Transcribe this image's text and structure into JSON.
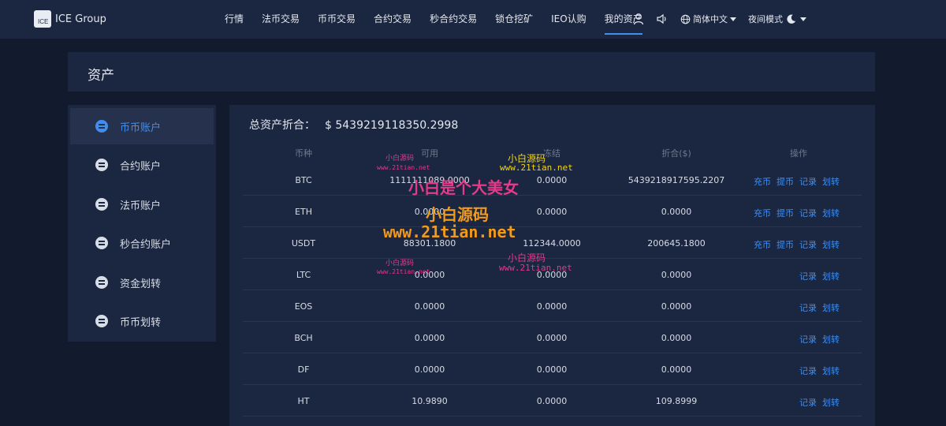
{
  "header": {
    "logo_mark": "ICE",
    "brand": "ICE Group",
    "nav": [
      {
        "label": "行情"
      },
      {
        "label": "法币交易"
      },
      {
        "label": "币币交易"
      },
      {
        "label": "合约交易"
      },
      {
        "label": "秒合约交易"
      },
      {
        "label": "锁仓挖矿"
      },
      {
        "label": "IEO认购"
      },
      {
        "label": "我的资产"
      }
    ],
    "active_nav": "我的资产",
    "language": "简体中文",
    "night_mode": "夜间模式"
  },
  "page": {
    "title": "资产"
  },
  "sidebar": {
    "items": [
      {
        "label": "币币账户",
        "active": true
      },
      {
        "label": "合约账户"
      },
      {
        "label": "法币账户"
      },
      {
        "label": "秒合约账户"
      },
      {
        "label": "资金划转"
      },
      {
        "label": "币币划转"
      }
    ]
  },
  "summary": {
    "label": "总资产折合：",
    "value": "$ 5439219118350.2998"
  },
  "table": {
    "columns": [
      "币种",
      "可用",
      "冻结",
      "折合($)",
      "操作"
    ],
    "action_labels": {
      "deposit": "充币",
      "withdraw": "提币",
      "record": "记录",
      "transfer": "划转"
    },
    "rows": [
      {
        "coin": "BTC",
        "available": "1111111089.0000",
        "frozen": "0.0000",
        "value": "5439218917595.2207",
        "full_actions": true
      },
      {
        "coin": "ETH",
        "available": "0.0000",
        "frozen": "0.0000",
        "value": "0.0000",
        "full_actions": true
      },
      {
        "coin": "USDT",
        "available": "88301.1800",
        "frozen": "112344.0000",
        "value": "200645.1800",
        "full_actions": true
      },
      {
        "coin": "LTC",
        "available": "0.0000",
        "frozen": "0.0000",
        "value": "0.0000",
        "full_actions": false
      },
      {
        "coin": "EOS",
        "available": "0.0000",
        "frozen": "0.0000",
        "value": "0.0000",
        "full_actions": false
      },
      {
        "coin": "BCH",
        "available": "0.0000",
        "frozen": "0.0000",
        "value": "0.0000",
        "full_actions": false
      },
      {
        "coin": "DF",
        "available": "0.0000",
        "frozen": "0.0000",
        "value": "0.0000",
        "full_actions": false
      },
      {
        "coin": "HT",
        "available": "10.9890",
        "frozen": "0.0000",
        "value": "109.8999",
        "full_actions": false
      }
    ]
  },
  "watermarks": [
    {
      "text": "小白源码",
      "color": "#e23b8a"
    },
    {
      "text": "www.21tian.net",
      "color": "#e23b8a"
    },
    {
      "text": "小白源码",
      "color": "#f2d51a"
    },
    {
      "text": "www.21tian.net",
      "color": "#f2d51a"
    },
    {
      "text": "小白是个大美女",
      "color": "#e23b8a"
    },
    {
      "text": "小白源码",
      "color": "#f29a1a"
    },
    {
      "text": "www.21tian.net",
      "color": "#f29a1a"
    },
    {
      "text": "小白源码",
      "color": "#e23b8a"
    },
    {
      "text": "www.21tian.net",
      "color": "#e23b8a"
    },
    {
      "text": "小白源码",
      "color": "#e23b8a"
    },
    {
      "text": "www.21tian.net",
      "color": "#e23b8a"
    }
  ],
  "colors": {
    "accent": "#3f8ef0",
    "background": "#121b2e",
    "panel": "#1b2640"
  }
}
